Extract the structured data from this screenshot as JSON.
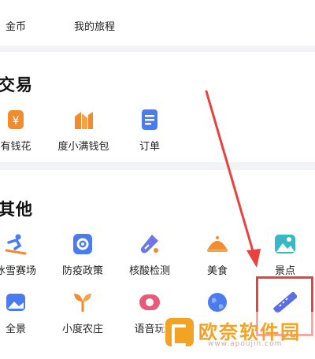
{
  "top_row": [
    {
      "label": "金币",
      "icon": "coin-icon"
    },
    {
      "label": "我的旅程",
      "icon": "trip-icon"
    }
  ],
  "trade": {
    "title": "交易",
    "items": [
      {
        "label": "有钱花",
        "icon": "yuan-icon"
      },
      {
        "label": "度小满钱包",
        "icon": "wallet-icon"
      },
      {
        "label": "订单",
        "icon": "order-icon"
      }
    ]
  },
  "other": {
    "title": "其他",
    "row1": [
      {
        "label": "冰雪赛场",
        "icon": "skiing-icon"
      },
      {
        "label": "防疫政策",
        "icon": "gear-icon"
      },
      {
        "label": "核酸检测",
        "icon": "test-tube-icon"
      },
      {
        "label": "美食",
        "icon": "food-icon"
      },
      {
        "label": "景点",
        "icon": "landscape-icon"
      }
    ],
    "row2": [
      {
        "label": "全景",
        "icon": "panorama-icon"
      },
      {
        "label": "小度农庄",
        "icon": "sprout-icon"
      },
      {
        "label": "语音玩",
        "icon": "voice-icon"
      },
      {
        "label": "",
        "icon": "globe-icon"
      },
      {
        "label": "",
        "icon": "ruler-icon"
      }
    ]
  },
  "watermark": {
    "text": "欧奈软件园",
    "url": "www.apoujin.com"
  },
  "colors": {
    "highlight": "#e8413e",
    "blue": "#4a7cf0",
    "orange": "#f28a2e"
  }
}
